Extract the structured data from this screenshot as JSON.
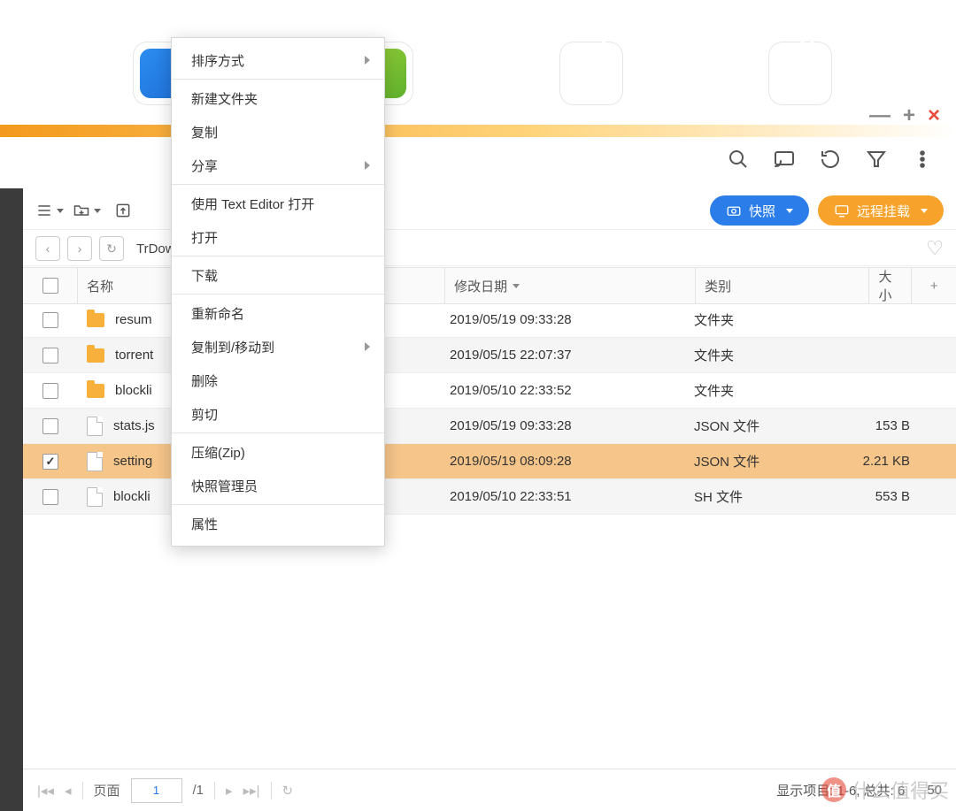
{
  "window_controls": {
    "minimize": "—",
    "maximize": "+",
    "close": "×"
  },
  "toolbar": {
    "snapshot_label": "快照",
    "remote_mount_label": "远程挂载"
  },
  "pathbar": {
    "breadcrumb": "TrDow"
  },
  "columns": {
    "name": "名称",
    "date": "修改日期",
    "type": "类别",
    "size": "大小",
    "add": "+"
  },
  "rows": [
    {
      "checked": false,
      "kind": "folder",
      "name": "resum",
      "date": "2019/05/19 09:33:28",
      "type": "文件夹",
      "size": ""
    },
    {
      "checked": false,
      "kind": "folder",
      "name": "torrent",
      "date": "2019/05/15 22:07:37",
      "type": "文件夹",
      "size": ""
    },
    {
      "checked": false,
      "kind": "folder",
      "name": "blockli",
      "date": "2019/05/10 22:33:52",
      "type": "文件夹",
      "size": ""
    },
    {
      "checked": false,
      "kind": "file",
      "name": "stats.js",
      "date": "2019/05/19 09:33:28",
      "type": "JSON 文件",
      "size": "153 B"
    },
    {
      "checked": true,
      "kind": "file",
      "name": "setting",
      "date": "2019/05/19 08:09:28",
      "type": "JSON 文件",
      "size": "2.21 KB"
    },
    {
      "checked": false,
      "kind": "file",
      "name": "blockli",
      "date": "2019/05/10 22:33:51",
      "type": "SH 文件",
      "size": "553 B"
    }
  ],
  "context_menu": [
    {
      "label": "排序方式",
      "sub": true
    },
    {
      "sep": true
    },
    {
      "label": "新建文件夹"
    },
    {
      "label": "复制"
    },
    {
      "label": "分享",
      "sub": true
    },
    {
      "sep": true
    },
    {
      "label": "使用 Text Editor 打开"
    },
    {
      "label": "打开"
    },
    {
      "sep": true
    },
    {
      "label": "下载"
    },
    {
      "sep": true
    },
    {
      "label": "重新命名"
    },
    {
      "label": "复制到/移动到",
      "sub": true
    },
    {
      "label": "删除"
    },
    {
      "label": "剪切"
    },
    {
      "sep": true
    },
    {
      "label": "压缩(Zip)"
    },
    {
      "label": "快照管理员"
    },
    {
      "sep": true
    },
    {
      "label": "属性"
    }
  ],
  "pager": {
    "page_label": "页面",
    "current": "1",
    "total": "/1",
    "summary": "显示项目:  1-6, 总共:  6",
    "per_page": "50"
  },
  "watermark": "什么值得买"
}
